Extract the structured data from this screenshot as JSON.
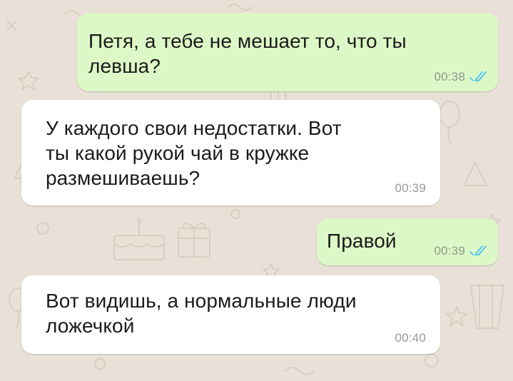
{
  "theme": {
    "wallpaper_color": "#e9e1d7",
    "outgoing_bubble_color": "#dcf8c6",
    "incoming_bubble_color": "#ffffff",
    "read_tick_color": "#4fc3f7"
  },
  "messages": [
    {
      "direction": "outgoing",
      "text": "Петя, а тебе не мешает то, что ты\nлевша?",
      "time": "00:38",
      "status_icon": "double-check-read-icon"
    },
    {
      "direction": "incoming",
      "text": "У каждого свои недостатки. Вот\nты какой рукой чай в кружке\nразмешиваешь?",
      "time": "00:39"
    },
    {
      "direction": "outgoing",
      "text": "Правой",
      "time": "00:39",
      "status_icon": "double-check-read-icon"
    },
    {
      "direction": "incoming",
      "text": "Вот видишь, а нормальные люди\nложечкой",
      "time": "00:40"
    }
  ]
}
